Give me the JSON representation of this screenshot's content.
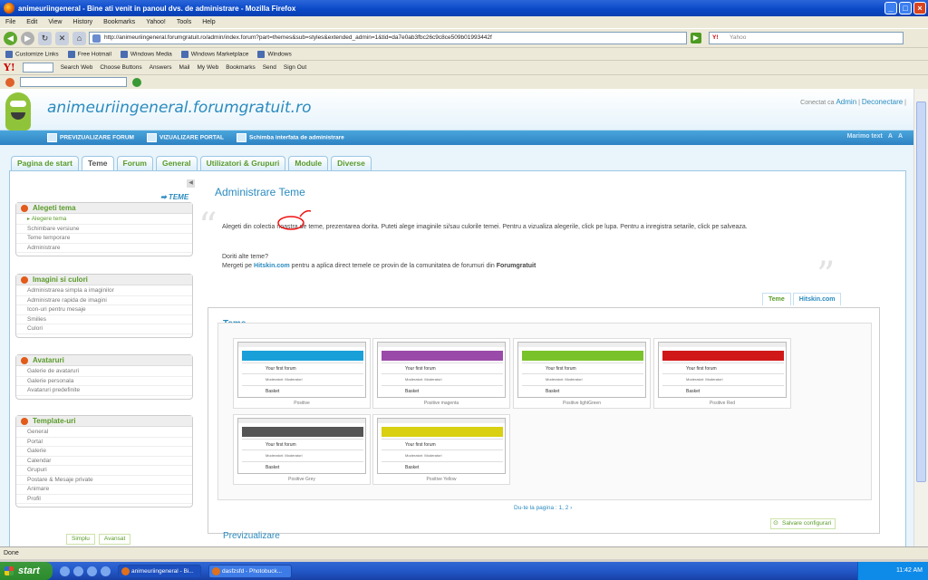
{
  "window": {
    "title": "animeuriingeneral - Bine ati venit in panoul dvs. de administrare - Mozilla Firefox"
  },
  "menu": [
    "File",
    "Edit",
    "View",
    "History",
    "Bookmarks",
    "Yahoo!",
    "Tools",
    "Help"
  ],
  "nav": {
    "url": "http://animeuriingeneral.forumgratuit.ro/admin/index.forum?part=themes&sub=styles&extended_admin=1&tid=da7e0ab3fbc26c9c8ce509b01993442f",
    "search_placeholder": "Yahoo"
  },
  "bookmarks": [
    "Customize Links",
    "Free Hotmail",
    "Windows Media",
    "Windows Marketplace",
    "Windows"
  ],
  "yahoo_toolbar": {
    "logo": "Y!",
    "items": [
      "Search Web",
      "Choose Buttons",
      "Answers",
      "Mail",
      "My Web",
      "Bookmarks",
      "Send",
      "Sign Out"
    ]
  },
  "site": {
    "title": "animeuriingeneral.forumgratuit.ro",
    "connected_label": "Conectat ca",
    "admin_link": "Admin",
    "logout_link": "Deconectare"
  },
  "admin_bar": {
    "links": [
      "PREVIZUALIZARE FORUM",
      "VIZUALIZARE PORTAL",
      "Schimba interfata de administrare"
    ],
    "right": "Marimo text"
  },
  "tabs": [
    "Pagina de start",
    "Teme",
    "Forum",
    "General",
    "Utilizatori & Grupuri",
    "Module",
    "Diverse"
  ],
  "sidebar": {
    "heading": "➡ TEME",
    "boxes": [
      {
        "title": "Alegeti tema",
        "items": [
          "Alegere tema",
          "Schimbare versiune",
          "Teme temporare",
          "Administrare"
        ]
      },
      {
        "title": "Imagini si culori",
        "items": [
          "Administrarea simpla a imaginilor",
          "Administrare rapida de imagini",
          "Icon-uri pentru mesaje",
          "Smilies",
          "Culori"
        ]
      },
      {
        "title": "Avataruri",
        "items": [
          "Galerie de avataruri",
          "Galerie personala",
          "Avataruri predefinite"
        ]
      },
      {
        "title": "Template-uri",
        "items": [
          "General",
          "Portal",
          "Galerie",
          "Calendar",
          "Grupuri",
          "Postare & Mesaje private",
          "Animare",
          "Profil"
        ]
      }
    ],
    "mode_simple": "Simplu",
    "mode_advanced": "Avansat"
  },
  "main": {
    "title": "Administrare Teme",
    "intro": "Alegeti din colectia noastra de teme, prezentarea dorita. Puteti alege imaginile si/sau culorile temei. Pentru a vizualiza alegerile, click pe lupa. Pentru a inregistra setarile, click pe salveaza.",
    "more_question": "Doriti alte teme?",
    "more_pre": "Mergeti pe",
    "more_link": "Hitskin.com",
    "more_mid": "pentru a aplica direct temele ce provin de la comunitatea de forumuri din",
    "more_brand": "Forumgratuit",
    "right_tabs": [
      "Teme",
      "Hitskin.com"
    ],
    "box_title": "Teme",
    "themes": [
      {
        "name": "Positive",
        "color": "#1aa0d8",
        "forum": "Your first forum",
        "mods": "Moderatori: Moderatori",
        "basket": "Basket"
      },
      {
        "name": "Positive magenta",
        "color": "#9a4aa8",
        "forum": "Your first forum",
        "mods": "Moderatori: Moderatori",
        "basket": "Basket"
      },
      {
        "name": "Positive lightGreen",
        "color": "#7ac22a",
        "forum": "Your first forum",
        "mods": "Moderatori: Moderatori",
        "basket": "Basket"
      },
      {
        "name": "Positive Red",
        "color": "#d01818",
        "forum": "Your first forum",
        "mods": "Moderatori: Moderatori",
        "basket": "Basket"
      },
      {
        "name": "Positive Grey",
        "color": "#555555",
        "forum": "Your first forum",
        "mods": "Moderatori: Moderatori",
        "basket": "Basket"
      },
      {
        "name": "Positive Yellow",
        "color": "#d8d010",
        "forum": "Your first forum",
        "mods": "Moderatori: Moderatori",
        "basket": "Basket"
      }
    ],
    "pager": "Du-te la pagina : 1, 2 ›",
    "save": "Salvare configurari",
    "preview": "Previzualizare"
  },
  "status": "Done",
  "taskbar": {
    "start": "start",
    "tasks": [
      "animeuriingeneral - Bi...",
      "dasfzsfd - Photobuck..."
    ],
    "clock": "11:42 AM"
  }
}
